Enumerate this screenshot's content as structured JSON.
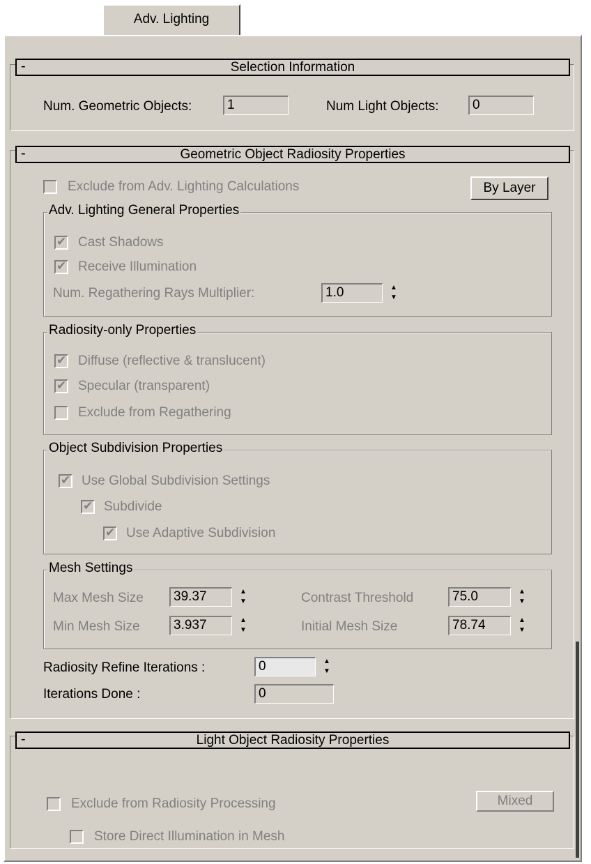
{
  "tab": {
    "label": "Adv. Lighting"
  },
  "selection_info": {
    "title": "Selection Information",
    "collapse": "-",
    "num_geometric_label": "Num. Geometric Objects:",
    "num_geometric_value": "1",
    "num_light_label": "Num Light Objects:",
    "num_light_value": "0"
  },
  "geometric": {
    "title": "Geometric Object Radiosity Properties",
    "collapse": "-",
    "exclude_label": "Exclude from Adv. Lighting Calculations",
    "by_layer_button": "By Layer",
    "general": {
      "title": "Adv. Lighting General Properties",
      "cast_shadows": "Cast Shadows",
      "receive_illumination": "Receive Illumination",
      "regather_label": "Num. Regathering Rays Multiplier:",
      "regather_value": "1.0"
    },
    "radiosity_only": {
      "title": "Radiosity-only Properties",
      "diffuse": "Diffuse (reflective & translucent)",
      "specular": "Specular (transparent)",
      "exclude_regather": "Exclude from Regathering"
    },
    "subdivision": {
      "title": "Object Subdivision Properties",
      "use_global": "Use Global Subdivision Settings",
      "subdivide": "Subdivide",
      "adaptive": "Use Adaptive Subdivision"
    },
    "mesh": {
      "title": "Mesh Settings",
      "max_label": "Max Mesh Size",
      "max_value": "39.37",
      "min_label": "Min Mesh Size",
      "min_value": "3.937",
      "contrast_label": "Contrast Threshold",
      "contrast_value": "75.0",
      "initial_label": "Initial Mesh Size",
      "initial_value": "78.74"
    },
    "refine_label": "Radiosity Refine Iterations :",
    "refine_value": "0",
    "done_label": "Iterations Done :",
    "done_value": "0"
  },
  "light": {
    "title": "Light Object Radiosity Properties",
    "collapse": "-",
    "exclude_label": "Exclude from Radiosity Processing",
    "mixed_button": "Mixed",
    "store_label": "Store Direct Illumination in Mesh"
  },
  "icons": {
    "check": "✔",
    "up": "▲",
    "down": "▼"
  }
}
